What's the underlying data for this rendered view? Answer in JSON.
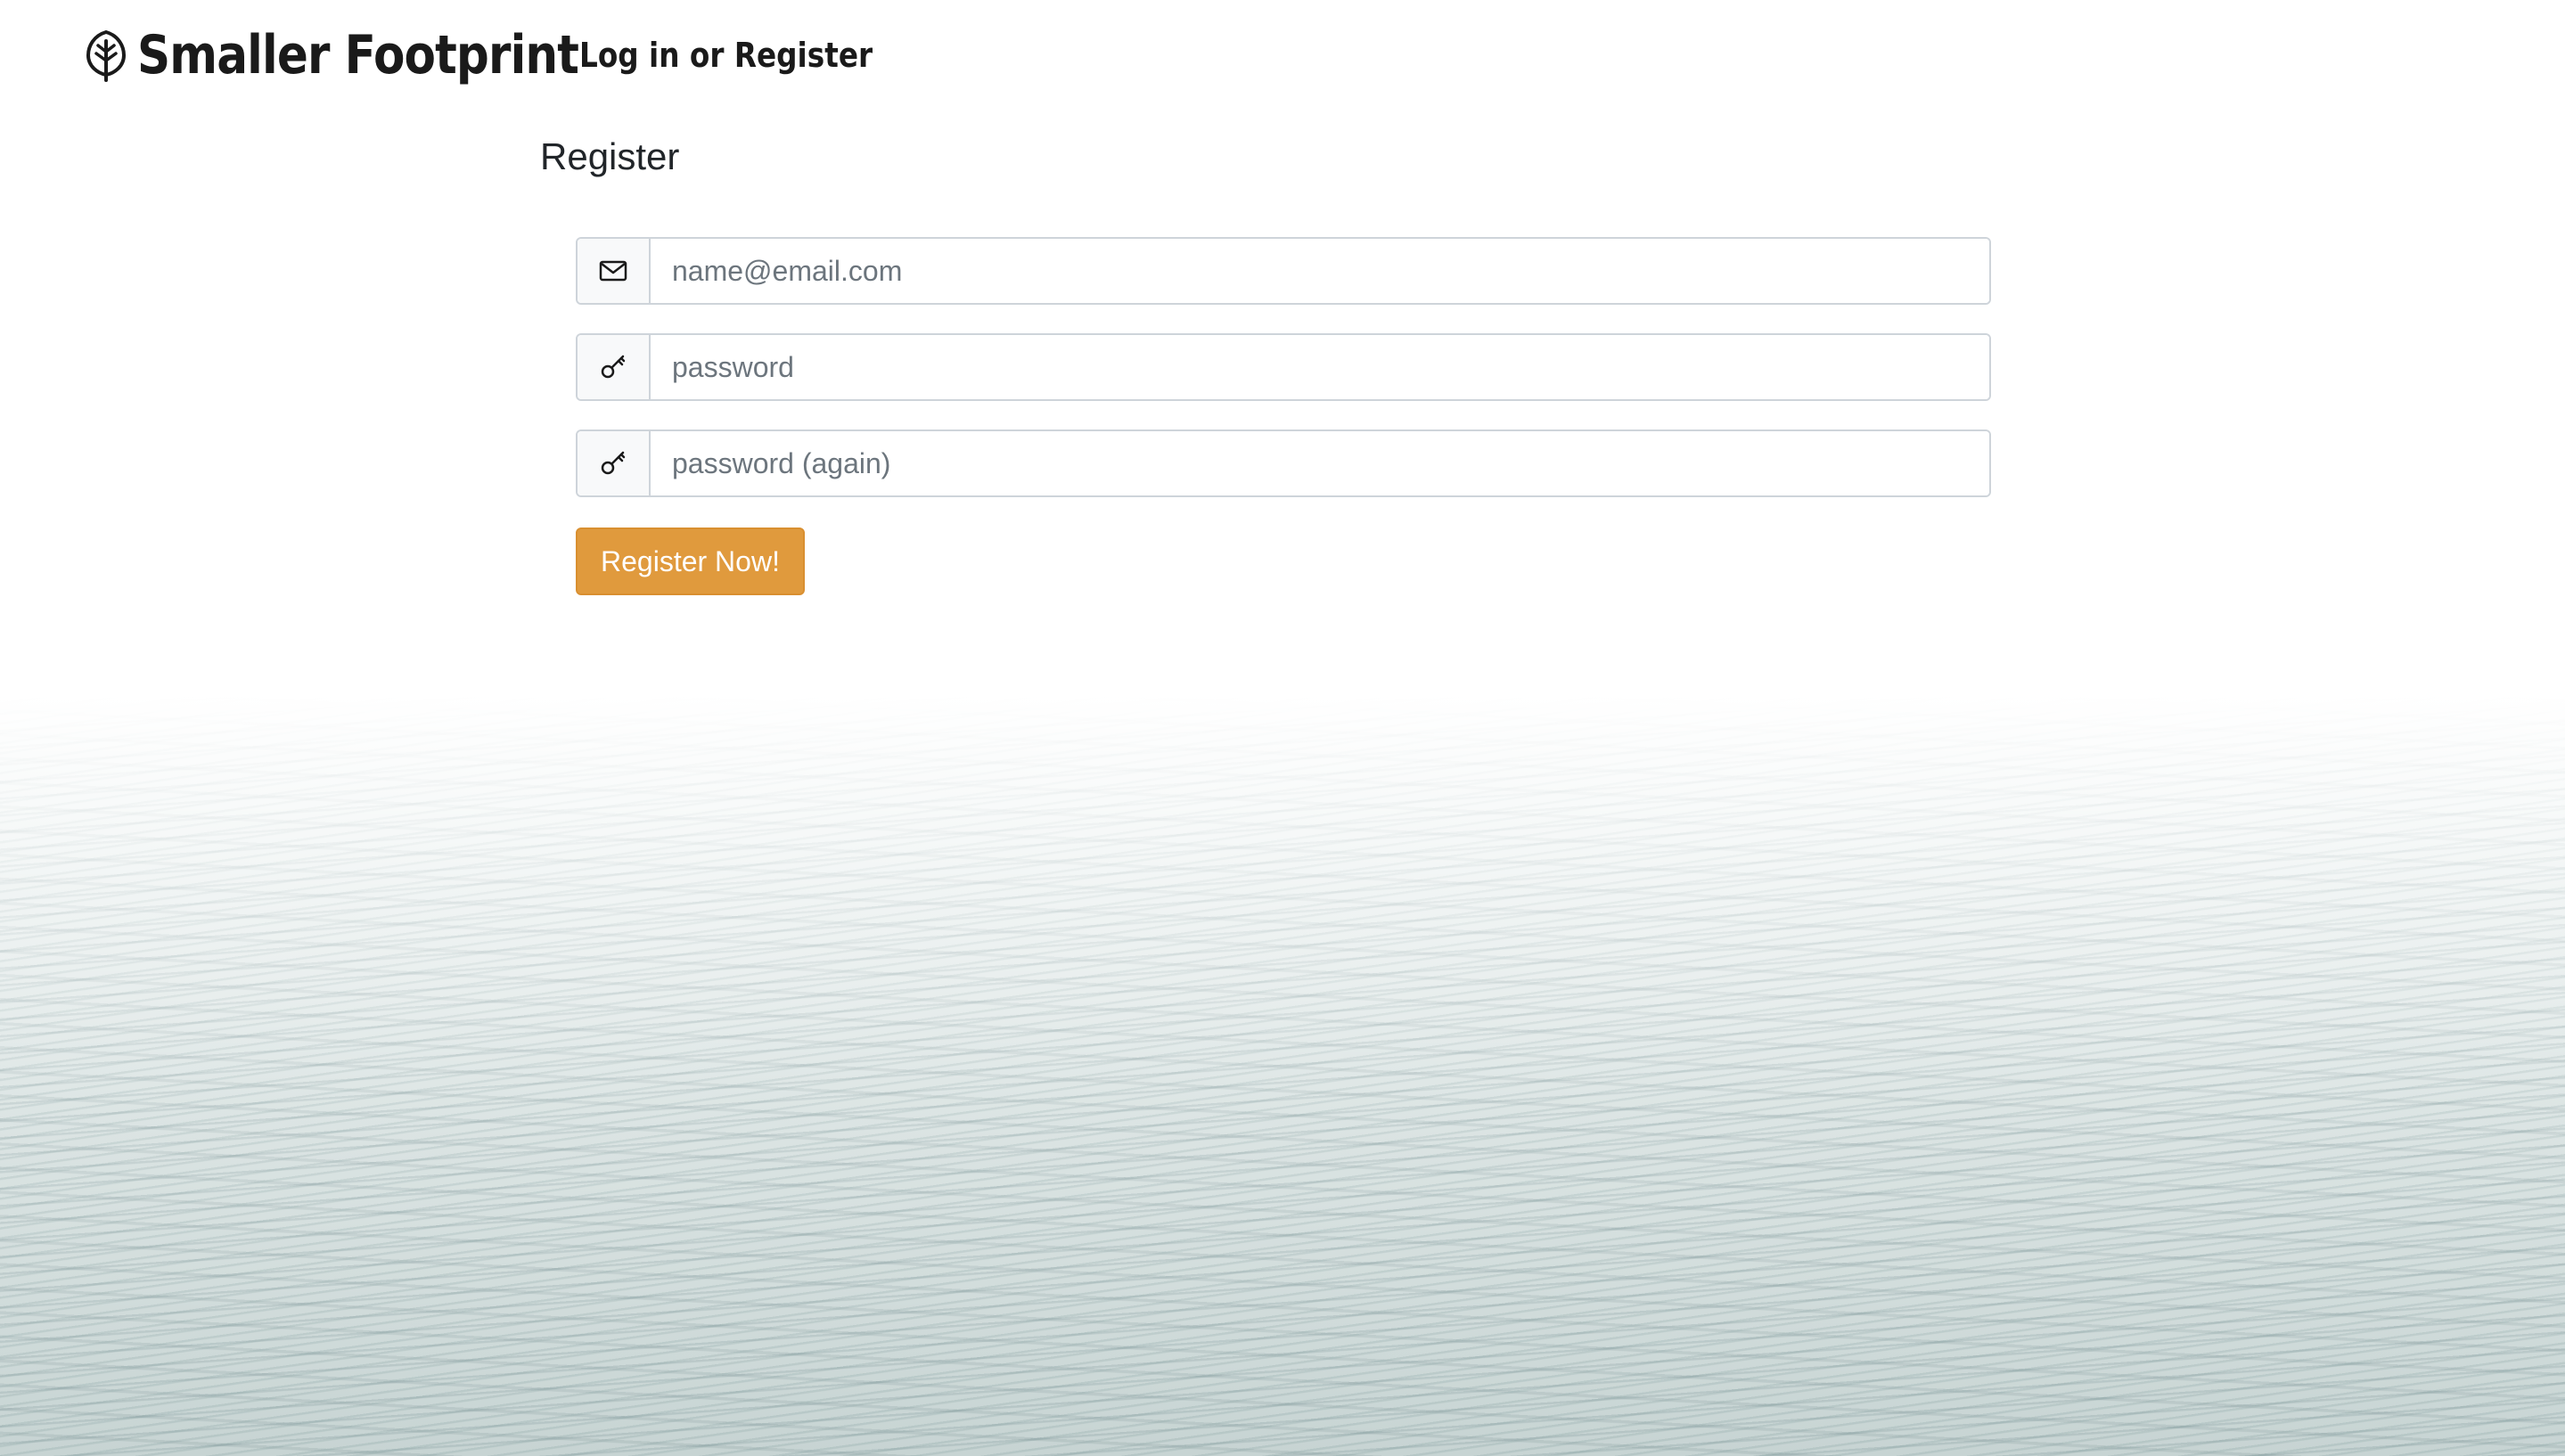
{
  "brand": {
    "name": "Smaller Footprint",
    "icon": "leaf-icon"
  },
  "nav": {
    "auth_link": "Log in or Register"
  },
  "page": {
    "title": "Register"
  },
  "form": {
    "email": {
      "icon": "envelope-icon",
      "value": "",
      "placeholder": "name@email.com"
    },
    "password": {
      "icon": "key-icon",
      "value": "",
      "placeholder": "password"
    },
    "password_again": {
      "icon": "key-icon",
      "value": "",
      "placeholder": "password (again)"
    },
    "submit_label": "Register Now!"
  },
  "colors": {
    "accent": "#e09a3d",
    "text": "#1a1a1a",
    "border": "#ced4da"
  }
}
